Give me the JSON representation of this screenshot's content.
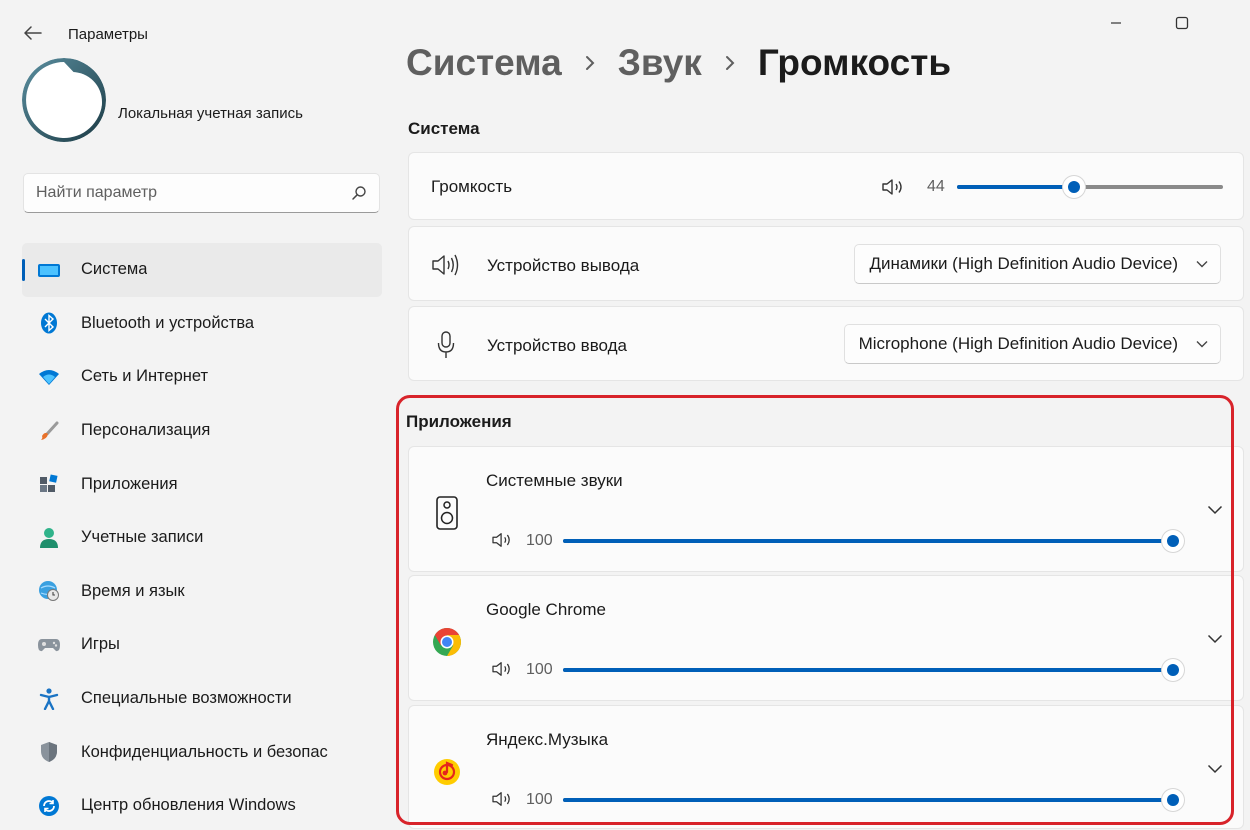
{
  "window": {
    "title": "Параметры"
  },
  "account": {
    "name": "Локальная учетная запись"
  },
  "search": {
    "placeholder": "Найти параметр"
  },
  "nav": [
    {
      "label": "Система",
      "icon": "system-monitor-icon",
      "active": true
    },
    {
      "label": "Bluetooth и устройства",
      "icon": "bluetooth-icon"
    },
    {
      "label": "Сеть и Интернет",
      "icon": "wifi-icon"
    },
    {
      "label": "Персонализация",
      "icon": "paint-brush-icon"
    },
    {
      "label": "Приложения",
      "icon": "apps-icon"
    },
    {
      "label": "Учетные записи",
      "icon": "user-icon"
    },
    {
      "label": "Время и язык",
      "icon": "globe-clock-icon"
    },
    {
      "label": "Игры",
      "icon": "gamepad-icon"
    },
    {
      "label": "Специальные возможности",
      "icon": "accessibility-icon"
    },
    {
      "label": "Конфиденциальность и безопас",
      "icon": "shield-icon"
    },
    {
      "label": "Центр обновления Windows",
      "icon": "windows-update-icon"
    }
  ],
  "breadcrumb": {
    "level1": "Система",
    "level2": "Звук",
    "current": "Громкость"
  },
  "system": {
    "heading": "Система",
    "volume": {
      "label": "Громкость",
      "value": "44",
      "level": 0.44
    },
    "output": {
      "label": "Устройство вывода",
      "selected": "Динамики (High Definition Audio Device)"
    },
    "input": {
      "label": "Устройство ввода",
      "selected": "Microphone (High Definition Audio Device)"
    }
  },
  "apps": {
    "heading": "Приложения",
    "items": [
      {
        "name": "Системные звуки",
        "icon": "system-sounds-icon",
        "value": "100",
        "level": 1.0
      },
      {
        "name": "Google Chrome",
        "icon": "chrome-icon",
        "value": "100",
        "level": 1.0
      },
      {
        "name": "Яндекс.Музыка",
        "icon": "yandex-music-icon",
        "value": "100",
        "level": 1.0
      }
    ]
  },
  "colors": {
    "accent": "#005fb8",
    "highlight": "#d8232a"
  }
}
